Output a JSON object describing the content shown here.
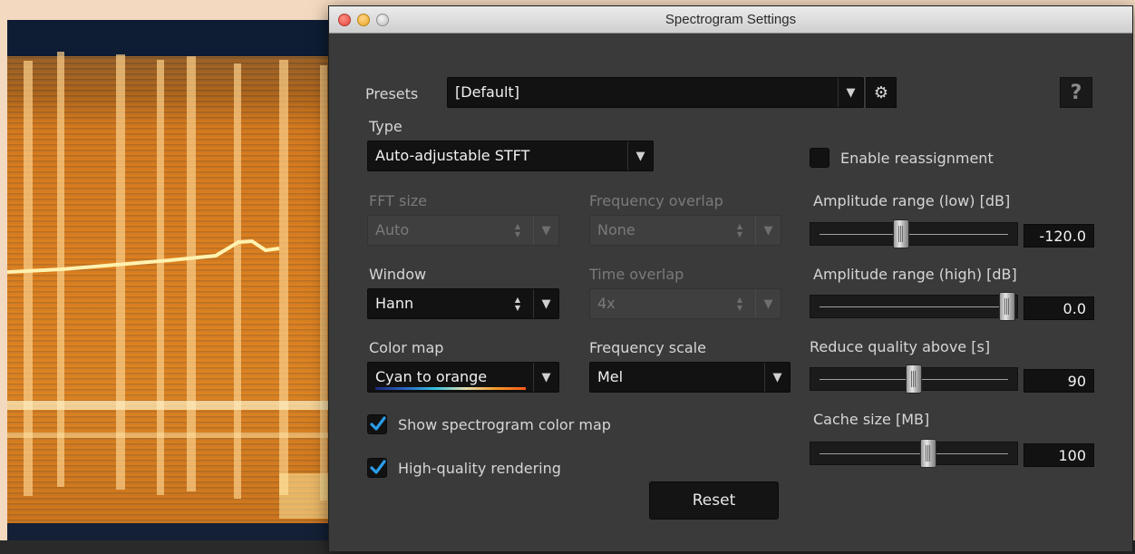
{
  "window": {
    "title": "Spectrogram Settings"
  },
  "presets": {
    "label": "Presets",
    "value": "[Default]"
  },
  "type": {
    "label": "Type",
    "value": "Auto-adjustable STFT"
  },
  "fft_size": {
    "label": "FFT size",
    "value": "Auto"
  },
  "frequency_overlap": {
    "label": "Frequency overlap",
    "value": "None"
  },
  "window_fn": {
    "label": "Window",
    "value": "Hann"
  },
  "time_overlap": {
    "label": "Time overlap",
    "value": "4x"
  },
  "color_map": {
    "label": "Color map",
    "value": "Cyan to orange"
  },
  "frequency_scale": {
    "label": "Frequency scale",
    "value": "Mel"
  },
  "show_color_map": {
    "label": "Show spectrogram color map",
    "checked": true
  },
  "high_quality": {
    "label": "High-quality rendering",
    "checked": true
  },
  "reassignment": {
    "label": "Enable reassignment",
    "checked": false
  },
  "amp_low": {
    "label": "Amplitude range (low)  [dB]",
    "value": "-120.0",
    "level": 0.43
  },
  "amp_high": {
    "label": "Amplitude range (high)  [dB]",
    "value": "0.0",
    "level": 1.0
  },
  "reduce_quality": {
    "label": "Reduce quality above [s]",
    "value": "90",
    "level": 0.5
  },
  "cache_size": {
    "label": "Cache size [MB]",
    "value": "100",
    "level": 0.58
  },
  "reset": {
    "label": "Reset"
  },
  "help": {
    "label": "?"
  },
  "colors": {
    "accent_check": "#2a9de8",
    "panel": "#3a3a3a",
    "field": "#121212"
  }
}
